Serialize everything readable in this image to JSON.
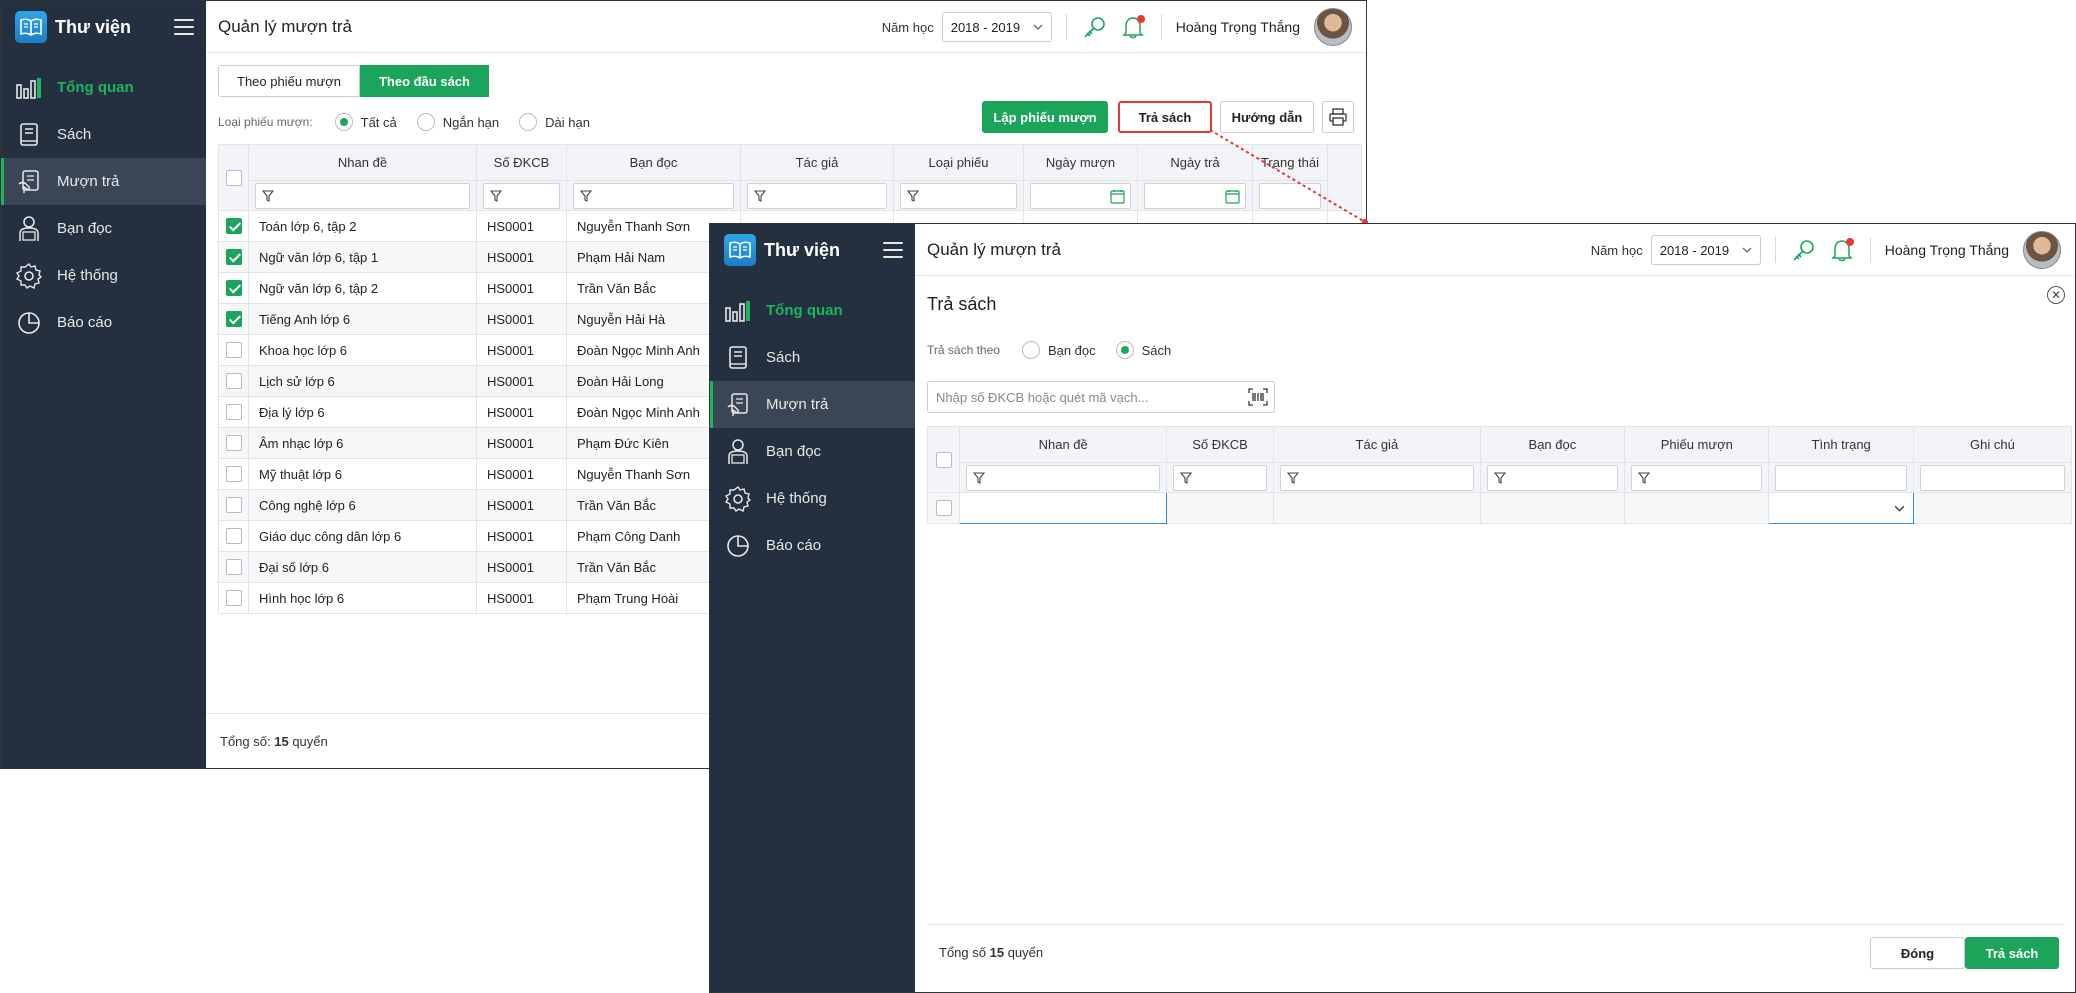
{
  "app": {
    "title": "Thư viện",
    "page_title": "Quản lý mượn trả"
  },
  "header": {
    "year_label": "Năm học",
    "year_value": "2018 - 2019",
    "user_name": "Hoàng Trọng  Thắng"
  },
  "sidebar": {
    "items": [
      {
        "label": "Tổng quan",
        "icon": "chart-bars-icon"
      },
      {
        "label": "Sách",
        "icon": "book-icon"
      },
      {
        "label": "Mượn trả",
        "icon": "borrow-return-icon"
      },
      {
        "label": "Bạn đọc",
        "icon": "reader-icon"
      },
      {
        "label": "Hệ thống",
        "icon": "gear-icon"
      },
      {
        "label": "Báo cáo",
        "icon": "pie-chart-icon"
      }
    ]
  },
  "window_a": {
    "tabs": [
      "Theo phiếu mượn",
      "Theo đầu sách"
    ],
    "filter_label": "Loại phiếu mượn:",
    "filter_options": [
      "Tất cả",
      "Ngắn hạn",
      "Dài hạn"
    ],
    "buttons": {
      "create": "Lập phiếu mượn",
      "return": "Trả sách",
      "guide": "Hướng dẫn"
    },
    "columns": [
      "Nhan đề",
      "Số ĐKCB",
      "Bạn đọc",
      "Tác giả",
      "Loại phiếu",
      "Ngày mượn",
      "Ngày trả",
      "Trạng thái"
    ],
    "rows": [
      {
        "title": "Toán lớp 6, tập 2",
        "code": "HS0001",
        "reader": "Nguyễn Thanh Sơn",
        "checked": true
      },
      {
        "title": "Ngữ văn lớp 6, tập 1",
        "code": "HS0001",
        "reader": "Phạm Hải Nam",
        "checked": true
      },
      {
        "title": "Ngữ văn lớp 6, tập 2",
        "code": "HS0001",
        "reader": "Trần Văn Bắc",
        "checked": true
      },
      {
        "title": "Tiếng Anh lớp 6",
        "code": "HS0001",
        "reader": "Nguyễn Hải Hà",
        "checked": true
      },
      {
        "title": "Khoa học lớp 6",
        "code": "HS0001",
        "reader": "Đoàn Ngọc Minh Anh",
        "checked": false
      },
      {
        "title": "Lịch sử lớp 6",
        "code": "HS0001",
        "reader": "Đoàn Hải Long",
        "checked": false
      },
      {
        "title": "Địa lý lớp 6",
        "code": "HS0001",
        "reader": "Đoàn Ngọc Minh Anh",
        "checked": false
      },
      {
        "title": "Âm nhạc lớp 6",
        "code": "HS0001",
        "reader": "Phạm Đức Kiên",
        "checked": false
      },
      {
        "title": "Mỹ thuật lớp 6",
        "code": "HS0001",
        "reader": "Nguyễn Thanh Sơn",
        "checked": false
      },
      {
        "title": "Công nghệ lớp 6",
        "code": "HS0001",
        "reader": "Trần Văn Bắc",
        "checked": false
      },
      {
        "title": "Giáo dục công dân lớp 6",
        "code": "HS0001",
        "reader": "Phạm Công Danh",
        "checked": false
      },
      {
        "title": "Đại số lớp 6",
        "code": "HS0001",
        "reader": "Trần Văn Bắc",
        "checked": false
      },
      {
        "title": "Hình học lớp 6",
        "code": "HS0001",
        "reader": "Phạm Trung Hoài",
        "checked": false
      }
    ],
    "footer_prefix": "Tổng số:",
    "footer_count": "15",
    "footer_suffix": "quyển"
  },
  "window_b": {
    "dialog_title": "Trả sách",
    "return_by_label": "Trả sách theo",
    "return_by_options": [
      "Bạn đọc",
      "Sách"
    ],
    "scan_placeholder": "Nhập số ĐKCB hoặc quét mã vạch...",
    "columns": [
      "Nhan đề",
      "Số ĐKCB",
      "Tác giả",
      "Bạn đọc",
      "Phiếu mượn",
      "Tình trạng",
      "Ghi chú"
    ],
    "footer_prefix": "Tổng số",
    "footer_count": "15",
    "footer_suffix": "quyển",
    "buttons": {
      "close": "Đóng",
      "return": "Trả sách"
    }
  },
  "colors": {
    "accent": "#1aa55a",
    "sidebar": "#24303f",
    "highlight": "#e53935"
  }
}
